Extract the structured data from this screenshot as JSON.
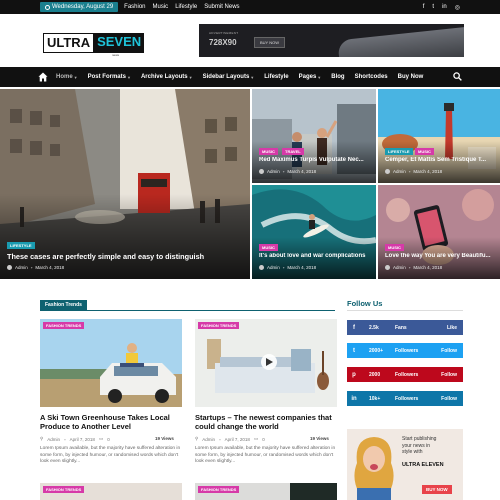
{
  "topbar": {
    "date": "Wednesday, August 29",
    "links": [
      "Fashion",
      "Music",
      "Lifestyle",
      "Submit News"
    ],
    "social_icons": [
      "facebook-icon",
      "twitter-icon",
      "linkedin-icon",
      "instagram-icon"
    ]
  },
  "logo": {
    "part1": "ULTRA",
    "part2": "SEVEN",
    "sub": "news"
  },
  "ad": {
    "label": "ADVERTISEMENT",
    "size": "728X90",
    "button": "BUY NOW"
  },
  "nav": {
    "items": [
      {
        "label": "Home",
        "dropdown": true
      },
      {
        "label": "Post Formats",
        "dropdown": true
      },
      {
        "label": "Archive Layouts",
        "dropdown": true
      },
      {
        "label": "Sidebar Layouts",
        "dropdown": true
      },
      {
        "label": "Lifestyle",
        "dropdown": false
      },
      {
        "label": "Pages",
        "dropdown": true
      },
      {
        "label": "Blog",
        "dropdown": false
      },
      {
        "label": "Shortcodes",
        "dropdown": false
      },
      {
        "label": "Buy Now",
        "dropdown": false
      }
    ]
  },
  "hero": {
    "main": {
      "tag": "LIFESTYLE",
      "title": "These cases are perfectly simple and easy to distinguish",
      "author": "Admin",
      "date": "March 4, 2018"
    },
    "tiles": [
      {
        "tags": [
          "MUSIC",
          "TRAVEL"
        ],
        "title": "Red Maximus Turpis Vulputate Nec...",
        "author": "Admin",
        "date": "March 4, 2018"
      },
      {
        "tags": [
          "LIFESTYLE",
          "MUSIC"
        ],
        "title": "Cemper, Et Mattis Sem Tristique T...",
        "author": "Admin",
        "date": "March 4, 2018"
      },
      {
        "tags": [
          "MUSIC"
        ],
        "title": "It's about love and war complications",
        "author": "Admin",
        "date": "March 4, 2018"
      },
      {
        "tags": [
          "MUSIC"
        ],
        "title": "Love the way You are very Beautifu...",
        "author": "Admin",
        "date": "March 4, 2018"
      }
    ]
  },
  "fashion_trends": {
    "heading": "Fashion Trends",
    "cards": [
      {
        "tag": "FASHION TRENDS",
        "title": "A Ski Town Greenhouse Takes Local Produce to Another Level",
        "author": "Admin",
        "date": "April 7, 2018",
        "comments": "0",
        "views": "19 Views",
        "excerpt": "Lorem Ipsum available, but the majority have suffered alteration in some form, by injected humour, or randomised words which don't look even slightly..."
      },
      {
        "tag": "FASHION TRENDS",
        "title": "Startups – The newest companies that could change the world",
        "author": "Admin",
        "date": "April 7, 2018",
        "comments": "0",
        "views": "19 Views",
        "excerpt": "Lorem Ipsum available, but the majority have suffered alteration in some form, by injected humour, or randomised words which don't look even slightly..."
      }
    ],
    "bottom_tags": [
      "FASHION TRENDS",
      "FASHION TRENDS"
    ]
  },
  "follow": {
    "heading": "Follow Us",
    "bars": [
      {
        "icon": "facebook-icon",
        "count": "2.5k",
        "name": "Fans",
        "action": "Like",
        "color": "#3b5998"
      },
      {
        "icon": "twitter-icon",
        "count": "2000+",
        "name": "Followers",
        "action": "Follow",
        "color": "#1da1f2"
      },
      {
        "icon": "pinterest-icon",
        "count": "2000",
        "name": "Followers",
        "action": "Follow",
        "color": "#bd081c"
      },
      {
        "icon": "linkedin-icon",
        "count": "10k+",
        "name": "Followers",
        "action": "Follow",
        "color": "#0e76a8"
      }
    ]
  },
  "promo": {
    "text": [
      "Start publishing",
      "your news in",
      "style with"
    ],
    "brand": "ULTRA ELEVEN",
    "button": "BUY NOW"
  },
  "colors": {
    "accent": "#0e6170",
    "tag_pink": "#d63aa8",
    "tag_teal": "#1a9bb0",
    "buy_red": "#e8434a"
  }
}
